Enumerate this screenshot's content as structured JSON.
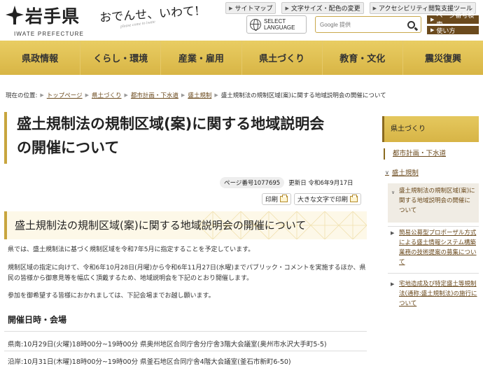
{
  "header": {
    "logo_title": "岩手県",
    "logo_sub": "IWATE PREFECTURE",
    "slogan": "おでんせ、いわて!",
    "slogan_sub": "please come to iwate",
    "top_links": [
      "サイトマップ",
      "文字サイズ・配色の変更",
      "アクセシビリティ閲覧支援ツール"
    ],
    "lang_label_1": "SELECT",
    "lang_label_2": "LANGUAGE",
    "search_placeholder": "Google 提供",
    "page_search": "ページ番号検索",
    "howto": "使い方"
  },
  "nav": [
    "県政情報",
    "くらし・環境",
    "産業・雇用",
    "県土づくり",
    "教育・文化",
    "震災復興"
  ],
  "breadcrumb": {
    "label": "現在の位置:",
    "links": [
      "トップページ",
      "県土づくり",
      "都市計画・下水道",
      "盛土規制"
    ],
    "current": "盛土規制法の規制区域(案)に関する地域説明会の開催について"
  },
  "main": {
    "title_line1": "盛土規制法の規制区域(案)に関する地域説明会",
    "title_line2": "の開催について",
    "page_number": "ページ番号1077695",
    "updated": "更新日 令和6年9月17日",
    "print": "印刷",
    "print_large": "大きな文字で印刷",
    "heading": "盛土規制法の規制区域(案)に関する地域説明会の開催について",
    "p1": "県では、盛土規制法に基づく規制区域を令和7年5月に指定することを予定しています。",
    "p2": "規制区域の指定に向けて、令和6年10月28日(月曜)から令和6年11月27日(水曜)までパブリック・コメントを実施するほか、県民の皆様から御意見等を幅広く頂戴するため、地域説明会を下記のとおり開催します。",
    "p3": "参加を御希望する皆様におかれましては、下記会場までお越し願います。",
    "schedule_heading": "開催日時・会場",
    "venue1": "県南:10月29日(火曜)18時00分~19時00分 県奥州地区合同庁舎分庁舎3階大会議室(奥州市水沢大手町5-5)",
    "venue2": "沿岸:10月31日(木曜)18時00分~19時00分 県釜石地区合同庁舎4階大会議室(釜石市新町6-50)"
  },
  "sidebar": {
    "head": "県土づくり",
    "l1": "都市計画・下水道",
    "group": "盛土規制",
    "current": "盛土規制法の規制区域(案)に関する地域説明会の開催について",
    "item2": "簡易公募型プロポーザル方式による盛土情報システム構築業務の技術提案の募集について",
    "item3": "宅地造成及び特定盛土等規制法(通称:盛土規制法)の施行について"
  },
  "colors": {
    "gold": "#d8b545",
    "brown": "#6b4a1d"
  }
}
